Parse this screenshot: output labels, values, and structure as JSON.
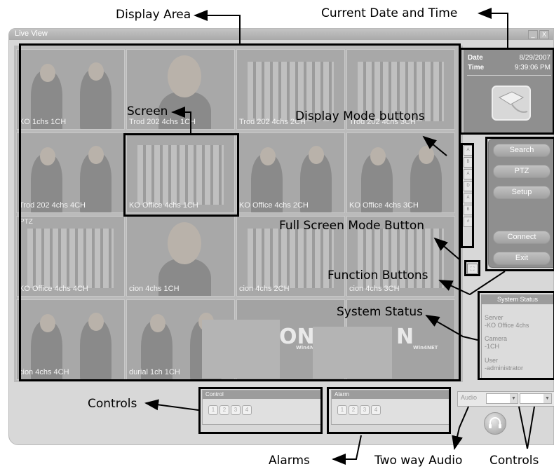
{
  "callouts": {
    "display_area": "Display Area",
    "current_date_time": "Current Date and Time",
    "screen": "Screen",
    "display_mode_buttons": "Display Mode buttons",
    "full_screen_mode_button": "Full Screen Mode Button",
    "function_buttons": "Function Buttons",
    "system_status": "System Status",
    "controls_left": "Controls",
    "alarms": "Alarms",
    "two_way_audio": "Two way Audio",
    "controls_right": "Controls"
  },
  "window": {
    "title": "Live View",
    "minimize": "_",
    "close": "X"
  },
  "cells": [
    {
      "label": "KO 1chs 1CH"
    },
    {
      "label": "Trod 202 4chs 1CH"
    },
    {
      "label": "Trod 202 4chs 2CH"
    },
    {
      "label": "Trod 202 4chs 3CH"
    },
    {
      "label": "Trod 202 4chs 4CH"
    },
    {
      "label": "KO Office 4chs 1CH"
    },
    {
      "label": "KO Office 4chs 2CH"
    },
    {
      "label": "KO Office 4chs 3CH"
    },
    {
      "label": "KO Office 4chs 4CH",
      "ptz": "PTZ"
    },
    {
      "label": "cion 4chs 1CH"
    },
    {
      "label": "cion 4chs 2CH"
    },
    {
      "label": "cion 4chs 3CH"
    },
    {
      "label": "cion 4chs 4CH"
    },
    {
      "label": "durial 1ch 1CH"
    }
  ],
  "logos": [
    {
      "text": "ON",
      "sub": "Win4NET"
    },
    {
      "text": "N",
      "sub": "Win4NET"
    }
  ],
  "datetime": {
    "date_label": "Date",
    "date_value": "8/29/2007",
    "time_label": "Time",
    "time_value": "9:39:06 PM"
  },
  "display_modes": [
    "A",
    "B",
    "A",
    "D",
    "A",
    "B",
    "#"
  ],
  "fullscreen_icon": "expand-icon",
  "functions": {
    "search": "Search",
    "ptz": "PTZ",
    "setup": "Setup",
    "connect": "Connect",
    "exit": "Exit"
  },
  "system_status": {
    "title": "System Status",
    "server_label": "Server",
    "server_value": "-KO Office 4chs",
    "camera_label": "Camera",
    "camera_value": "-1CH",
    "user_label": "User",
    "user_value": "-administrator"
  },
  "control": {
    "title": "Control",
    "buttons": [
      "1",
      "2",
      "3",
      "4"
    ]
  },
  "alarm": {
    "title": "Alarm",
    "buttons": [
      "1",
      "2",
      "3",
      "4"
    ]
  },
  "audio": {
    "label": "Audio",
    "dropdown_glyph": "▼"
  }
}
